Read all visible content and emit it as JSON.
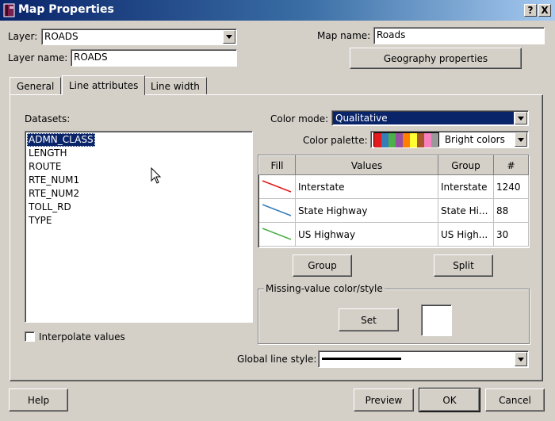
{
  "window": {
    "title": "Map Properties",
    "help_button": "?",
    "close_button": "X"
  },
  "layer": {
    "label": "Layer:",
    "value": "ROADS",
    "name_label": "Layer name:",
    "name_value": "ROADS"
  },
  "map": {
    "label": "Map name:",
    "value": "Roads",
    "geography_button": "Geography properties"
  },
  "tabs": [
    {
      "label": "General",
      "active": false
    },
    {
      "label": "Line attributes",
      "active": true
    },
    {
      "label": "Line width",
      "active": false
    }
  ],
  "datasets": {
    "label": "Datasets:",
    "items": [
      "ADMN_CLASS",
      "LENGTH",
      "ROUTE",
      "RTE_NUM1",
      "RTE_NUM2",
      "TOLL_RD",
      "TYPE"
    ],
    "selected_index": 0
  },
  "color_mode": {
    "label": "Color mode:",
    "value": "Qualitative"
  },
  "color_palette": {
    "label": "Color palette:",
    "value": "Bright colors",
    "swatches": [
      "#e41a1c",
      "#377eb8",
      "#4daf4a",
      "#984ea3",
      "#ff7f00",
      "#ffff33",
      "#a65628",
      "#f781bf",
      "#999999"
    ]
  },
  "table": {
    "headers": [
      "Fill",
      "Values",
      "Group",
      "#"
    ],
    "rows": [
      {
        "color": "#e41a1c",
        "value": "Interstate",
        "group": "Interstate",
        "count": "1240"
      },
      {
        "color": "#377eb8",
        "value": "State Highway",
        "group": "State Hi...",
        "count": "88"
      },
      {
        "color": "#4daf4a",
        "value": "US Highway",
        "group": "US High...",
        "count": "30"
      }
    ]
  },
  "actions": {
    "group": "Group",
    "split": "Split"
  },
  "missing": {
    "legend": "Missing-value color/style",
    "set_button": "Set"
  },
  "interpolate_label": "Interpolate values",
  "global_line_style_label": "Global line style:",
  "footer": {
    "help": "Help",
    "preview": "Preview",
    "ok": "OK",
    "cancel": "Cancel"
  },
  "icons": {
    "app": "map-book-icon",
    "dropdown": "chevron-down-icon",
    "cursor": "mouse-pointer-icon"
  },
  "colors": {
    "titlebar_start": "#0a246a",
    "titlebar_end": "#a6caf0",
    "face": "#d4d0c8",
    "selection": "#0a246a"
  }
}
